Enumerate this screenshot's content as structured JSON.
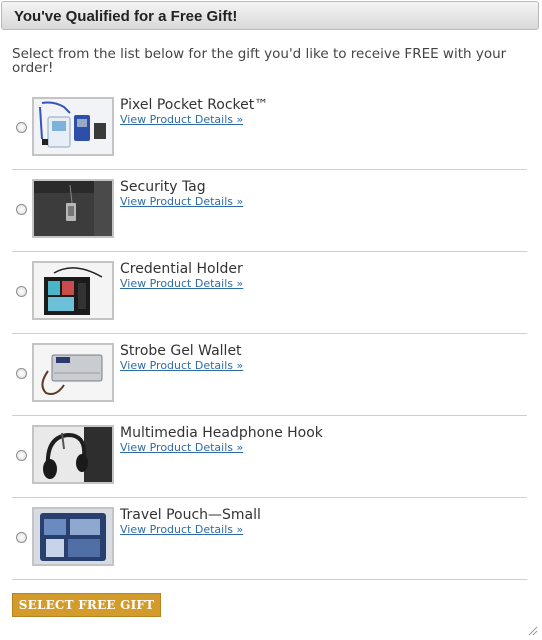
{
  "header": {
    "title": "You've Qualified for a Free Gift!"
  },
  "intro": "Select from the list below for the gift you'd like to receive FREE with your order!",
  "products": [
    {
      "name": "Pixel Pocket Rocket™",
      "link": "View Product Details »"
    },
    {
      "name": "Security Tag",
      "link": "View Product Details »"
    },
    {
      "name": "Credential Holder",
      "link": "View Product Details »"
    },
    {
      "name": "Strobe Gel Wallet",
      "link": "View Product Details »"
    },
    {
      "name": "Multimedia Headphone Hook",
      "link": "View Product Details »"
    },
    {
      "name": "Travel Pouch—Small",
      "link": "View Product Details »"
    }
  ],
  "button": {
    "label": "SELECT FREE GIFT »"
  },
  "colors": {
    "button": "#d29b2b",
    "link": "#2e6da4"
  }
}
